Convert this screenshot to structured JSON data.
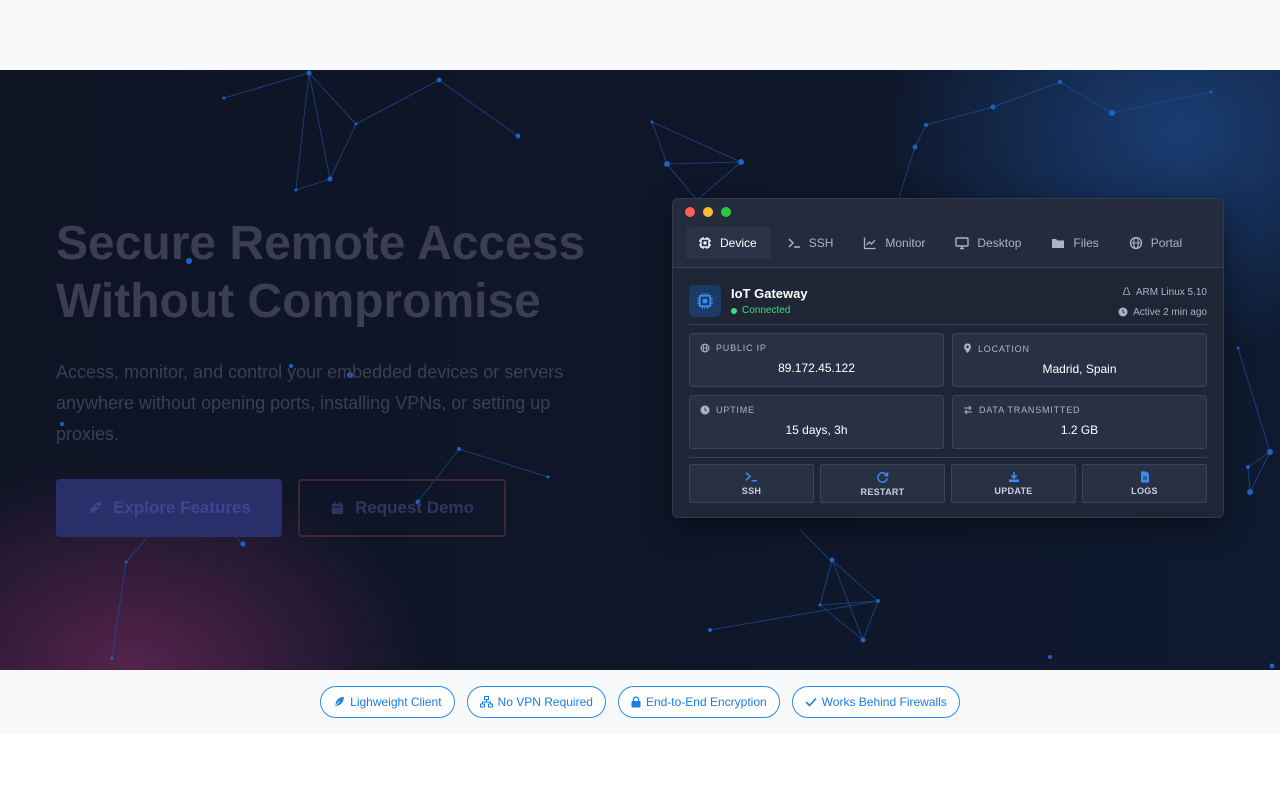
{
  "hero": {
    "title_line1": "Secure Remote Access",
    "title_line2": "Without Compromise",
    "subtitle": "Access, monitor, and control your embedded devices or servers anywhere without opening ports, installing VPNs, or setting up proxies.",
    "primary_button": "Explore Features",
    "secondary_button": "Request Demo"
  },
  "window": {
    "tabs": [
      {
        "label": "Device",
        "icon": "chip-icon",
        "active": true
      },
      {
        "label": "SSH",
        "icon": "terminal-icon",
        "active": false
      },
      {
        "label": "Monitor",
        "icon": "chart-icon",
        "active": false
      },
      {
        "label": "Desktop",
        "icon": "desktop-icon",
        "active": false
      },
      {
        "label": "Files",
        "icon": "folder-icon",
        "active": false
      },
      {
        "label": "Portal",
        "icon": "globe-icon",
        "active": false
      }
    ],
    "device": {
      "name": "IoT Gateway",
      "status": "Connected",
      "os": "ARM Linux 5.10",
      "last_active": "Active 2 min ago"
    },
    "stats": [
      {
        "label": "PUBLIC IP",
        "value": "89.172.45.122",
        "icon": "globe-icon"
      },
      {
        "label": "LOCATION",
        "value": "Madrid, Spain",
        "icon": "map-pin-icon"
      },
      {
        "label": "UPTIME",
        "value": "15 days, 3h",
        "icon": "clock-icon"
      },
      {
        "label": "DATA TRANSMITTED",
        "value": "1.2 GB",
        "icon": "transfer-icon"
      }
    ],
    "actions": [
      {
        "label": "SSH",
        "icon": "terminal-icon"
      },
      {
        "label": "RESTART",
        "icon": "restart-icon"
      },
      {
        "label": "UPDATE",
        "icon": "download-icon"
      },
      {
        "label": "LOGS",
        "icon": "file-icon"
      }
    ]
  },
  "features": [
    {
      "label": "Lighweight Client",
      "icon": "feather-icon"
    },
    {
      "label": "No VPN Required",
      "icon": "network-icon"
    },
    {
      "label": "End-to-End Encryption",
      "icon": "lock-icon"
    },
    {
      "label": "Works Behind Firewalls",
      "icon": "check-icon"
    }
  ],
  "colors": {
    "accent": "#1a7ee6",
    "connected": "#3ddc84",
    "window_bg": "#1e2535"
  }
}
